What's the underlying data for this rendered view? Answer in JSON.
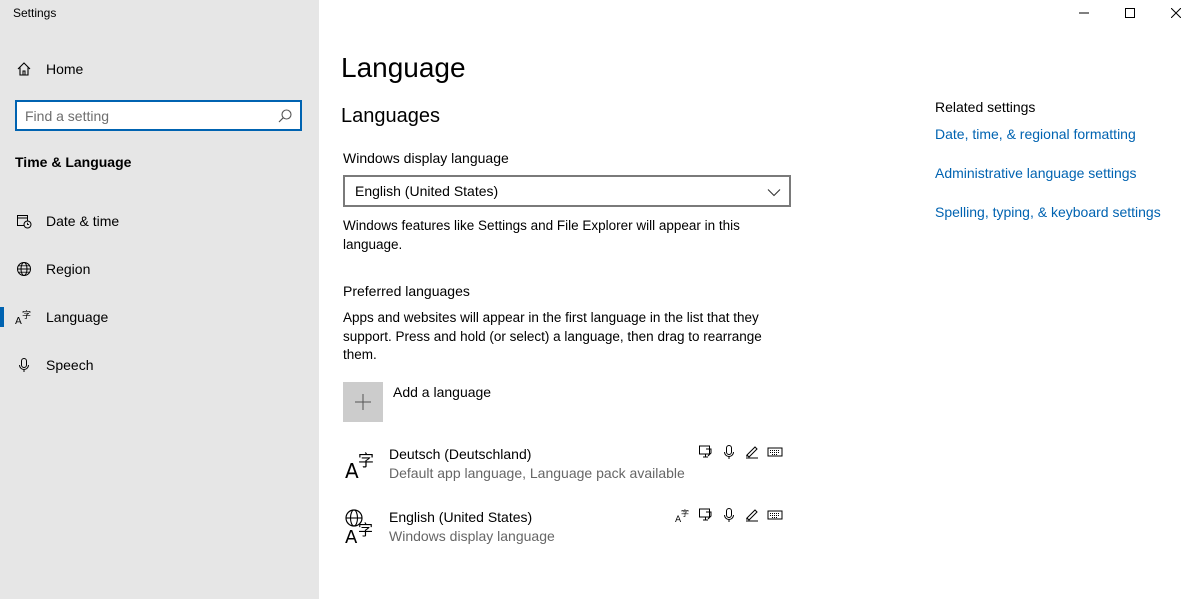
{
  "window": {
    "title": "Settings",
    "controls": {
      "minimize_icon": "minimize-icon",
      "maximize_icon": "maximize-icon",
      "close_icon": "close-icon"
    }
  },
  "sidebar": {
    "home_label": "Home",
    "search": {
      "placeholder": "Find a setting",
      "value": ""
    },
    "section_heading": "Time & Language",
    "items": [
      {
        "label": "Date & time",
        "icon": "calendar-clock-icon"
      },
      {
        "label": "Region",
        "icon": "globe-icon"
      },
      {
        "label": "Language",
        "icon": "language-icon",
        "active": true
      },
      {
        "label": "Speech",
        "icon": "microphone-icon"
      }
    ]
  },
  "main": {
    "title": "Language",
    "languages_heading": "Languages",
    "display_language": {
      "label": "Windows display language",
      "selected": "English (United States)",
      "description": "Windows features like Settings and File Explorer will appear in this language."
    },
    "preferred": {
      "heading": "Preferred languages",
      "description": "Apps and websites will appear in the first language in the list that they support. Press and hold (or select) a language, then drag to rearrange them.",
      "add_label": "Add a language",
      "languages": [
        {
          "name": "Deutsch (Deutschland)",
          "status": "Default app language, Language pack available"
        },
        {
          "name": "English (United States)",
          "status": "Windows display language"
        }
      ]
    }
  },
  "related": {
    "title": "Related settings",
    "links": [
      "Date, time, & regional formatting",
      "Administrative language settings",
      "Spelling, typing, & keyboard settings"
    ]
  },
  "colors": {
    "accent": "#0063b1",
    "sidebar_bg": "#e6e6e6",
    "tile_bg": "#cccccc"
  }
}
